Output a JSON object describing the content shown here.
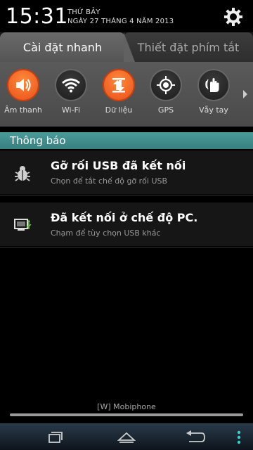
{
  "status": {
    "time": "15:31",
    "day": "THỨ BẢY",
    "date": "NGÀY 27 THÁNG 4 NĂM 2013"
  },
  "tabs": {
    "quick_settings": "Cài đặt nhanh",
    "shortcut_settings": "Thiết đặt phím tắt"
  },
  "quick_settings": [
    {
      "label": "Âm thanh",
      "icon": "volume-icon",
      "active": true
    },
    {
      "label": "Wi-Fi",
      "icon": "wifi-icon",
      "active": false
    },
    {
      "label": "Dữ liệu",
      "icon": "data-icon",
      "active": true
    },
    {
      "label": "GPS",
      "icon": "gps-icon",
      "active": false
    },
    {
      "label": "Vẫy tay",
      "icon": "hand-wave-icon",
      "active": false
    }
  ],
  "notifications": {
    "header": "Thông báo",
    "items": [
      {
        "title": "Gỡ rối USB đã kết nối",
        "subtitle": "Chọn để tắt chế độ gỡ rối USB",
        "icon": "usb-debug-icon"
      },
      {
        "title": "Đã kết nối ở chế độ PC.",
        "subtitle": "Chạm để tùy chọn USB khác",
        "icon": "usb-pc-icon"
      }
    ]
  },
  "carrier": "[W] Mobiphone",
  "colors": {
    "accent_orange": "#f26522",
    "teal_header": "#3f8a8a"
  }
}
